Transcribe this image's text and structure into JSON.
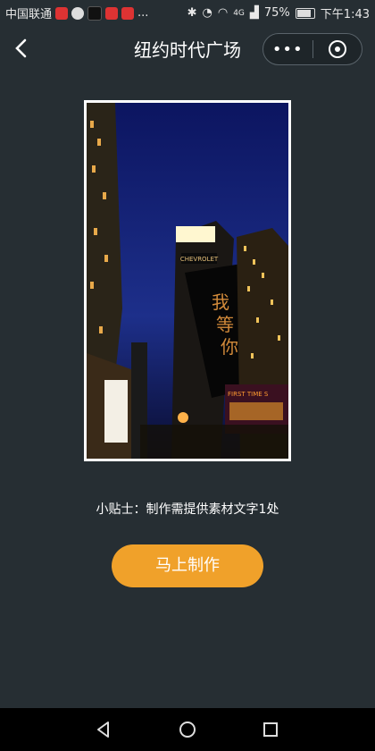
{
  "status_bar": {
    "carrier": "中国联通",
    "extra": "...",
    "signal": "4G",
    "battery": "75%",
    "time": "下午1:43"
  },
  "header": {
    "back_icon": "chevron-left-icon",
    "title": "纽约时代广场"
  },
  "capsule": {
    "more_icon": "more-dots-icon",
    "more_label": "•••",
    "close_icon": "target-icon"
  },
  "preview": {
    "billboard_text": [
      "我",
      "等",
      "你"
    ],
    "brand_sign": "CHEVROLET",
    "sign_text": "FIRST TIME S"
  },
  "tip": "小贴士：制作需提供素材文字1处",
  "action": {
    "make_label": "马上制作",
    "color": "#f0a12a"
  },
  "nav_bar": {
    "back_icon": "triangle-back-icon",
    "home_icon": "circle-home-icon",
    "recent_icon": "square-recents-icon"
  },
  "colors": {
    "background": "#262e33",
    "accent": "#f0a12a"
  }
}
